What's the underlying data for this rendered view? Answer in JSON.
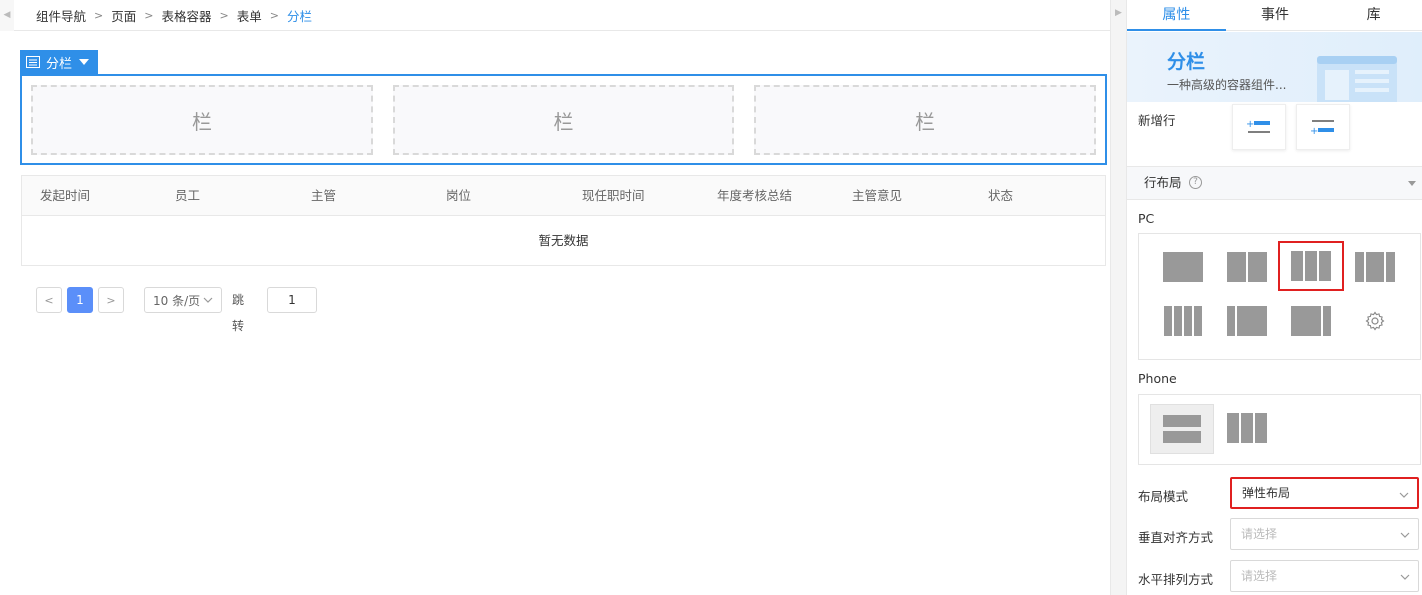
{
  "breadcrumb": {
    "items": [
      "组件导航",
      "页面",
      "表格容器",
      "表单"
    ],
    "current": "分栏"
  },
  "selected_component": {
    "label": "分栏"
  },
  "columns": [
    "栏",
    "栏",
    "栏"
  ],
  "table": {
    "headers": [
      "发起时间",
      "员工",
      "主管",
      "岗位",
      "现任职时间",
      "年度考核总结",
      "主管意见",
      "状态"
    ],
    "empty_text": "暂无数据"
  },
  "pagination": {
    "prev": "<",
    "current_page": "1",
    "next": ">",
    "page_size": "10 条/页",
    "jump_label": "跳转",
    "jump_value": "1"
  },
  "panel": {
    "tabs": [
      "属性",
      "事件",
      "库"
    ],
    "active_tab": "属性",
    "banner_title": "分栏",
    "banner_desc": "一种高级的容器组件...",
    "new_row_label": "新增行",
    "row_layout_label": "行布局",
    "help_mark": "?",
    "pc_label": "PC",
    "phone_label": "Phone",
    "layout_mode_label": "布局模式",
    "layout_mode_value": "弹性布局",
    "vertical_align_label": "垂直对齐方式",
    "vertical_align_placeholder": "请选择",
    "horizontal_arrange_label": "水平排列方式",
    "horizontal_arrange_placeholder": "请选择"
  },
  "colors": {
    "accent": "#2f8fe8",
    "highlight": "#e02020",
    "layout_block": "#999999"
  }
}
